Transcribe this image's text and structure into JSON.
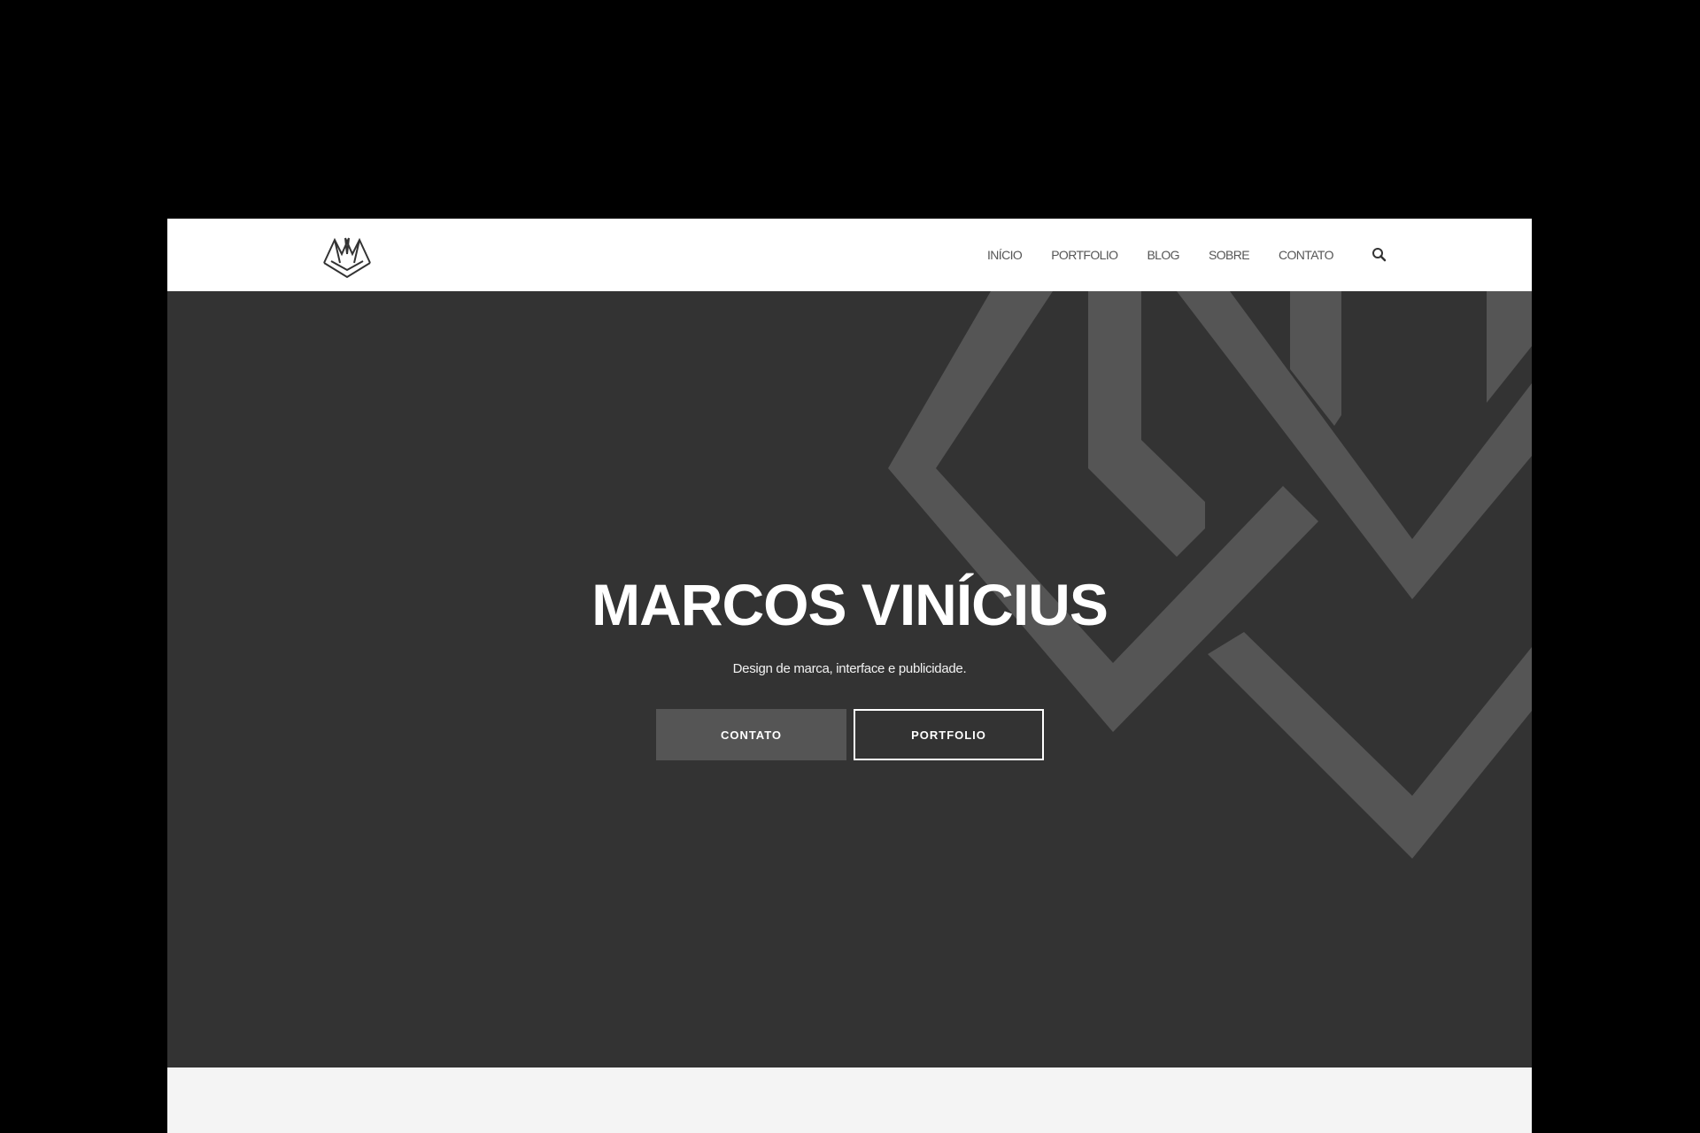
{
  "navbar": {
    "logo_icon": "mv-monogram-logo",
    "items": [
      {
        "label": "INÍCIO"
      },
      {
        "label": "PORTFOLIO"
      },
      {
        "label": "BLOG"
      },
      {
        "label": "SOBRE"
      },
      {
        "label": "CONTATO"
      }
    ],
    "search_icon": "search-icon"
  },
  "hero": {
    "title": "MARCOS VINÍCIUS",
    "subtitle": "Design de marca, interface e publicidade.",
    "primary_button": "CONTATO",
    "secondary_button": "PORTFOLIO",
    "background_motif": "geometric-monogram-pattern"
  },
  "colors": {
    "page_background": "#000000",
    "navbar": "#ffffff",
    "hero_background": "#333333",
    "hero_pattern": "#555555",
    "primary_button": "#555555",
    "text_light": "#ffffff",
    "nav_text": "#555555",
    "footer_strip": "#f4f4f4"
  }
}
